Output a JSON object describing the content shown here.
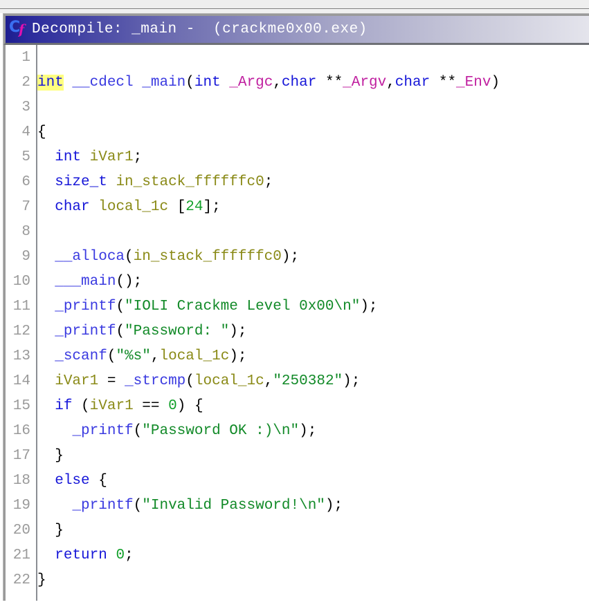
{
  "window": {
    "toolbar_strip": ""
  },
  "panel": {
    "icon": "decompile-c-function-icon",
    "icon_glyphs": {
      "primary": "C",
      "secondary": "f"
    },
    "title": "Decompile: _main -  (crackme0x00.exe)",
    "title_parts": {
      "label": "Decompile:",
      "function": "_main",
      "dash": "-",
      "binary": "(crackme0x00.exe)"
    }
  },
  "colors": {
    "titlebar_start": "#1d1d8f",
    "titlebar_end": "#e4e4ec",
    "type": "#1616d8",
    "function": "#3a3ae0",
    "variable": "#8a8a17",
    "parameter": "#c020a0",
    "string": "#128a28",
    "number": "#12a02a",
    "keyword": "#1616d8",
    "punctuation": "#000000",
    "highlight": "#ffff80",
    "line_number": "#9a9a9a",
    "background": "#ffffff"
  },
  "code": {
    "language": "c",
    "line_count": 22,
    "highlighted_token": "int",
    "lines": [
      {
        "n": "1",
        "text": ""
      },
      {
        "n": "2",
        "text": "int __cdecl _main(int _Argc,char **_Argv,char **_Env)"
      },
      {
        "n": "3",
        "text": ""
      },
      {
        "n": "4",
        "text": "{"
      },
      {
        "n": "5",
        "text": "  int iVar1;"
      },
      {
        "n": "6",
        "text": "  size_t in_stack_ffffffc0;"
      },
      {
        "n": "7",
        "text": "  char local_1c [24];"
      },
      {
        "n": "8",
        "text": ""
      },
      {
        "n": "9",
        "text": "  __alloca(in_stack_ffffffc0);"
      },
      {
        "n": "10",
        "text": "  ___main();"
      },
      {
        "n": "11",
        "text": "  _printf(\"IOLI Crackme Level 0x00\\n\");"
      },
      {
        "n": "12",
        "text": "  _printf(\"Password: \");"
      },
      {
        "n": "13",
        "text": "  _scanf(\"%s\",local_1c);"
      },
      {
        "n": "14",
        "text": "  iVar1 = _strcmp(local_1c,\"250382\");"
      },
      {
        "n": "15",
        "text": "  if (iVar1 == 0) {"
      },
      {
        "n": "16",
        "text": "    _printf(\"Password OK :)\\n\");"
      },
      {
        "n": "17",
        "text": "  }"
      },
      {
        "n": "18",
        "text": "  else {"
      },
      {
        "n": "19",
        "text": "    _printf(\"Invalid Password!\\n\");"
      },
      {
        "n": "20",
        "text": "  }"
      },
      {
        "n": "21",
        "text": "  return 0;"
      },
      {
        "n": "22",
        "text": "}"
      }
    ]
  }
}
